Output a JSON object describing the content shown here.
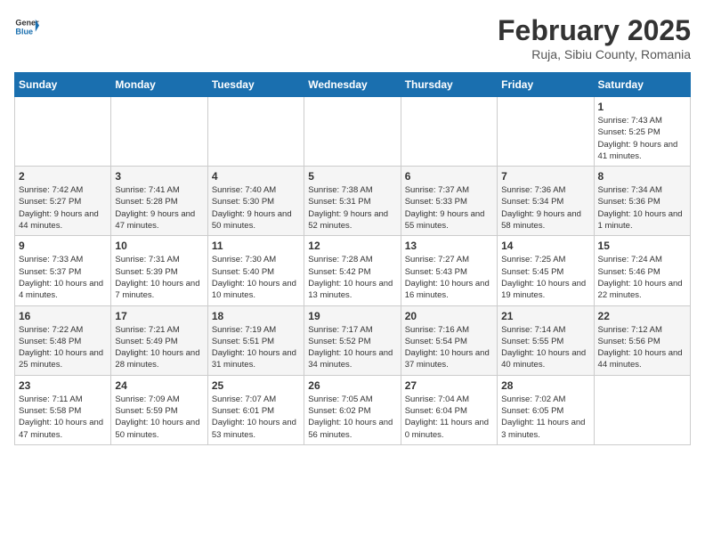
{
  "header": {
    "logo_general": "General",
    "logo_blue": "Blue",
    "month_title": "February 2025",
    "location": "Ruja, Sibiu County, Romania"
  },
  "weekdays": [
    "Sunday",
    "Monday",
    "Tuesday",
    "Wednesday",
    "Thursday",
    "Friday",
    "Saturday"
  ],
  "weeks": [
    [
      {
        "day": null,
        "info": null
      },
      {
        "day": null,
        "info": null
      },
      {
        "day": null,
        "info": null
      },
      {
        "day": null,
        "info": null
      },
      {
        "day": null,
        "info": null
      },
      {
        "day": null,
        "info": null
      },
      {
        "day": "1",
        "info": "Sunrise: 7:43 AM\nSunset: 5:25 PM\nDaylight: 9 hours and 41 minutes."
      }
    ],
    [
      {
        "day": "2",
        "info": "Sunrise: 7:42 AM\nSunset: 5:27 PM\nDaylight: 9 hours and 44 minutes."
      },
      {
        "day": "3",
        "info": "Sunrise: 7:41 AM\nSunset: 5:28 PM\nDaylight: 9 hours and 47 minutes."
      },
      {
        "day": "4",
        "info": "Sunrise: 7:40 AM\nSunset: 5:30 PM\nDaylight: 9 hours and 50 minutes."
      },
      {
        "day": "5",
        "info": "Sunrise: 7:38 AM\nSunset: 5:31 PM\nDaylight: 9 hours and 52 minutes."
      },
      {
        "day": "6",
        "info": "Sunrise: 7:37 AM\nSunset: 5:33 PM\nDaylight: 9 hours and 55 minutes."
      },
      {
        "day": "7",
        "info": "Sunrise: 7:36 AM\nSunset: 5:34 PM\nDaylight: 9 hours and 58 minutes."
      },
      {
        "day": "8",
        "info": "Sunrise: 7:34 AM\nSunset: 5:36 PM\nDaylight: 10 hours and 1 minute."
      }
    ],
    [
      {
        "day": "9",
        "info": "Sunrise: 7:33 AM\nSunset: 5:37 PM\nDaylight: 10 hours and 4 minutes."
      },
      {
        "day": "10",
        "info": "Sunrise: 7:31 AM\nSunset: 5:39 PM\nDaylight: 10 hours and 7 minutes."
      },
      {
        "day": "11",
        "info": "Sunrise: 7:30 AM\nSunset: 5:40 PM\nDaylight: 10 hours and 10 minutes."
      },
      {
        "day": "12",
        "info": "Sunrise: 7:28 AM\nSunset: 5:42 PM\nDaylight: 10 hours and 13 minutes."
      },
      {
        "day": "13",
        "info": "Sunrise: 7:27 AM\nSunset: 5:43 PM\nDaylight: 10 hours and 16 minutes."
      },
      {
        "day": "14",
        "info": "Sunrise: 7:25 AM\nSunset: 5:45 PM\nDaylight: 10 hours and 19 minutes."
      },
      {
        "day": "15",
        "info": "Sunrise: 7:24 AM\nSunset: 5:46 PM\nDaylight: 10 hours and 22 minutes."
      }
    ],
    [
      {
        "day": "16",
        "info": "Sunrise: 7:22 AM\nSunset: 5:48 PM\nDaylight: 10 hours and 25 minutes."
      },
      {
        "day": "17",
        "info": "Sunrise: 7:21 AM\nSunset: 5:49 PM\nDaylight: 10 hours and 28 minutes."
      },
      {
        "day": "18",
        "info": "Sunrise: 7:19 AM\nSunset: 5:51 PM\nDaylight: 10 hours and 31 minutes."
      },
      {
        "day": "19",
        "info": "Sunrise: 7:17 AM\nSunset: 5:52 PM\nDaylight: 10 hours and 34 minutes."
      },
      {
        "day": "20",
        "info": "Sunrise: 7:16 AM\nSunset: 5:54 PM\nDaylight: 10 hours and 37 minutes."
      },
      {
        "day": "21",
        "info": "Sunrise: 7:14 AM\nSunset: 5:55 PM\nDaylight: 10 hours and 40 minutes."
      },
      {
        "day": "22",
        "info": "Sunrise: 7:12 AM\nSunset: 5:56 PM\nDaylight: 10 hours and 44 minutes."
      }
    ],
    [
      {
        "day": "23",
        "info": "Sunrise: 7:11 AM\nSunset: 5:58 PM\nDaylight: 10 hours and 47 minutes."
      },
      {
        "day": "24",
        "info": "Sunrise: 7:09 AM\nSunset: 5:59 PM\nDaylight: 10 hours and 50 minutes."
      },
      {
        "day": "25",
        "info": "Sunrise: 7:07 AM\nSunset: 6:01 PM\nDaylight: 10 hours and 53 minutes."
      },
      {
        "day": "26",
        "info": "Sunrise: 7:05 AM\nSunset: 6:02 PM\nDaylight: 10 hours and 56 minutes."
      },
      {
        "day": "27",
        "info": "Sunrise: 7:04 AM\nSunset: 6:04 PM\nDaylight: 11 hours and 0 minutes."
      },
      {
        "day": "28",
        "info": "Sunrise: 7:02 AM\nSunset: 6:05 PM\nDaylight: 11 hours and 3 minutes."
      },
      {
        "day": null,
        "info": null
      }
    ]
  ]
}
